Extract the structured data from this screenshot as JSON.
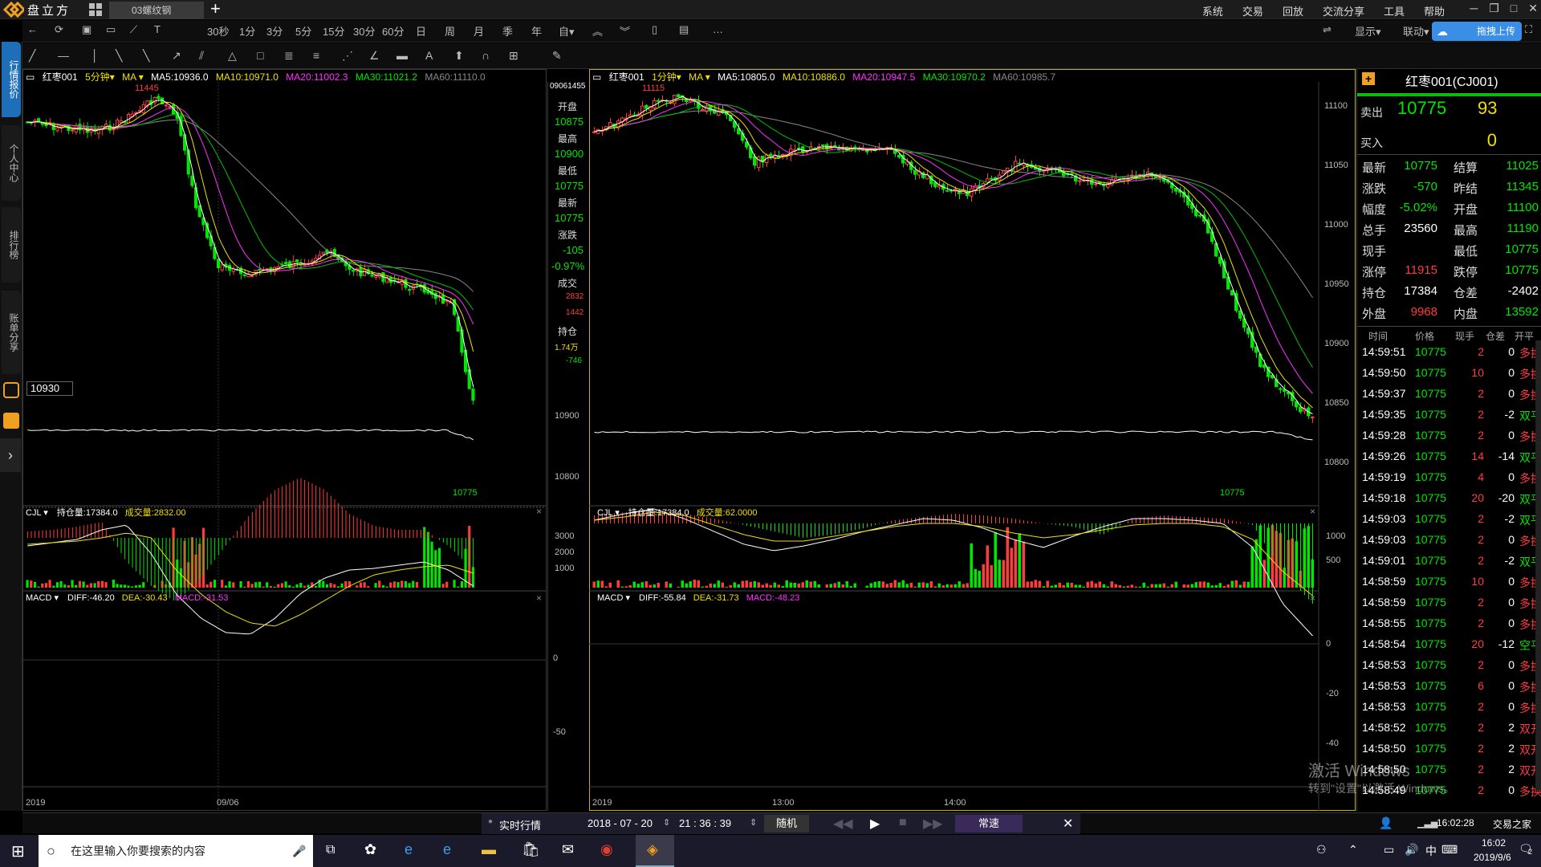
{
  "app": {
    "logo_text": "盘立方",
    "tab_title": "03螺纹钢",
    "menu": [
      "系统",
      "交易",
      "回放",
      "交流分享",
      "工具",
      "帮助"
    ],
    "upload_label": "拖拽上传"
  },
  "toolbar": {
    "periods": [
      "30秒",
      "1分",
      "3分",
      "5分",
      "15分",
      "30分",
      "60分",
      "日",
      "周",
      "月",
      "季",
      "年",
      "自▾"
    ],
    "right_items": [
      "显示▾",
      "联动▾"
    ]
  },
  "sidetabs": [
    "行情报价",
    "个人中心",
    "排行榜",
    "账单分享"
  ],
  "left_chart": {
    "header": {
      "symbol": "红枣001",
      "period": "5分钟▾",
      "ind": "MA ▾",
      "ma5": "MA5:10936.0",
      "ma10": "MA10:10971.0",
      "ma20": "MA20:11002.3",
      "ma30": "MA30:11021.2",
      "ma60": "MA60:11110.0"
    },
    "high_label": "11445",
    "low_label": "10775",
    "crosshair_price": "10930",
    "y_labels": [
      "10900",
      "10800"
    ],
    "info_panel": {
      "time": "09061455",
      "open_l": "开盘",
      "open_v": "10875",
      "high_l": "最高",
      "high_v": "10900",
      "low_l": "最低",
      "low_v": "10775",
      "last_l": "最新",
      "last_v": "10775",
      "chg_l": "涨跌",
      "chg_v": "-105",
      "pct_v": "-0.97%",
      "vol_l": "成交",
      "vol_v1": "2832",
      "vol_v2": "1442",
      "oi_l": "持仓",
      "oi_v1": "1.74万",
      "oi_v2": "-746"
    },
    "vol_header": {
      "name": "CJL ▾",
      "oi": "持仓量:17384.0",
      "vol": "成交量:2832.00"
    },
    "vol_y": [
      "3000",
      "2000",
      "1000"
    ],
    "macd_header": {
      "name": "MACD ▾",
      "diff": "DIFF:-46.20",
      "dea": "DEA:-30.43",
      "macd": "MACD:-31.53"
    },
    "macd_y": [
      "0",
      "-50"
    ],
    "x_labels": [
      "2019",
      "09/06"
    ]
  },
  "mid_chart": {
    "header": {
      "symbol": "红枣001",
      "period": "1分钟▾",
      "ind": "MA ▾",
      "ma5": "MA5:10805.0",
      "ma10": "MA10:10886.0",
      "ma20": "MA20:10947.5",
      "ma30": "MA30:10970.2",
      "ma60": "MA60:10985.7"
    },
    "high_label": "11115",
    "low_label": "10775",
    "y_labels": [
      "11100",
      "11050",
      "11000",
      "10950",
      "10900",
      "10850",
      "10800"
    ],
    "vol_header": {
      "name": "CJL ▾",
      "oi": "持仓量:17384.0",
      "vol": "成交量:62.0000"
    },
    "vol_y": [
      "1000",
      "500"
    ],
    "macd_header": {
      "name": "MACD ▾",
      "diff": "DIFF:-55.84",
      "dea": "DEA:-31.73",
      "macd": "MACD:-48.23"
    },
    "macd_y": [
      "0",
      "-20",
      "-40"
    ],
    "x_labels": [
      "2019",
      "13:00",
      "14:00"
    ]
  },
  "quote": {
    "title": "红枣001(CJ001)",
    "sell_l": "卖出",
    "sell_p": "10775",
    "sell_q": "93",
    "buy_l": "买入",
    "buy_q": "0",
    "rows": [
      {
        "l1": "最新",
        "v1": "10775",
        "c1": "green",
        "l2": "结算",
        "v2": "11025",
        "c2": "green"
      },
      {
        "l1": "涨跌",
        "v1": "-570",
        "c1": "green",
        "l2": "昨结",
        "v2": "11345",
        "c2": "green"
      },
      {
        "l1": "幅度",
        "v1": "-5.02%",
        "c1": "green",
        "l2": "开盘",
        "v2": "11100",
        "c2": "green"
      },
      {
        "l1": "总手",
        "v1": "23560",
        "c1": "white",
        "l2": "最高",
        "v2": "11190",
        "c2": "green"
      },
      {
        "l1": "现手",
        "v1": "",
        "c1": "white",
        "l2": "最低",
        "v2": "10775",
        "c2": "green"
      },
      {
        "l1": "涨停",
        "v1": "11915",
        "c1": "red",
        "l2": "跌停",
        "v2": "10775",
        "c2": "green"
      },
      {
        "l1": "持仓",
        "v1": "17384",
        "c1": "white",
        "l2": "仓差",
        "v2": "-2402",
        "c2": "white"
      },
      {
        "l1": "外盘",
        "v1": "9968",
        "c1": "red",
        "l2": "内盘",
        "v2": "13592",
        "c2": "green"
      }
    ],
    "tick_headers": [
      "时间",
      "价格",
      "现手",
      "仓差",
      "开平"
    ],
    "ticks": [
      {
        "t": "14:59:51",
        "p": "10775",
        "q": "2",
        "oi": "0",
        "f": "多换"
      },
      {
        "t": "14:59:50",
        "p": "10775",
        "q": "10",
        "oi": "0",
        "f": "多换"
      },
      {
        "t": "14:59:37",
        "p": "10775",
        "q": "2",
        "oi": "0",
        "f": "多换"
      },
      {
        "t": "14:59:35",
        "p": "10775",
        "q": "2",
        "oi": "-2",
        "f": "双平"
      },
      {
        "t": "14:59:28",
        "p": "10775",
        "q": "2",
        "oi": "0",
        "f": "多换"
      },
      {
        "t": "14:59:26",
        "p": "10775",
        "q": "14",
        "oi": "-14",
        "f": "双平"
      },
      {
        "t": "14:59:19",
        "p": "10775",
        "q": "4",
        "oi": "0",
        "f": "多换"
      },
      {
        "t": "14:59:18",
        "p": "10775",
        "q": "20",
        "oi": "-20",
        "f": "双平"
      },
      {
        "t": "14:59:03",
        "p": "10775",
        "q": "2",
        "oi": "-2",
        "f": "双平"
      },
      {
        "t": "14:59:03",
        "p": "10775",
        "q": "2",
        "oi": "0",
        "f": "多换"
      },
      {
        "t": "14:59:01",
        "p": "10775",
        "q": "2",
        "oi": "-2",
        "f": "双平"
      },
      {
        "t": "14:58:59",
        "p": "10775",
        "q": "10",
        "oi": "0",
        "f": "多换"
      },
      {
        "t": "14:58:59",
        "p": "10775",
        "q": "2",
        "oi": "0",
        "f": "多换"
      },
      {
        "t": "14:58:55",
        "p": "10775",
        "q": "2",
        "oi": "0",
        "f": "多换"
      },
      {
        "t": "14:58:54",
        "p": "10775",
        "q": "20",
        "oi": "-12",
        "f": "空平"
      },
      {
        "t": "14:58:53",
        "p": "10775",
        "q": "2",
        "oi": "0",
        "f": "多换"
      },
      {
        "t": "14:58:53",
        "p": "10775",
        "q": "6",
        "oi": "0",
        "f": "多换"
      },
      {
        "t": "14:58:53",
        "p": "10775",
        "q": "2",
        "oi": "0",
        "f": "多换"
      },
      {
        "t": "14:58:52",
        "p": "10775",
        "q": "2",
        "oi": "2",
        "f": "双开"
      },
      {
        "t": "14:58:50",
        "p": "10775",
        "q": "2",
        "oi": "2",
        "f": "双开"
      },
      {
        "t": "14:58:50",
        "p": "10775",
        "q": "2",
        "oi": "2",
        "f": "双开"
      },
      {
        "t": "14:58:49",
        "p": "10775",
        "q": "2",
        "oi": "0",
        "f": "多换"
      }
    ],
    "status_time": "16:02:28",
    "status_house": "交易之家"
  },
  "playbar": {
    "mode": "实时行情",
    "date": "2018 - 07 - 20",
    "time": "21 : 36 : 39",
    "random": "随机",
    "speed": "常速"
  },
  "watermark": {
    "line1": "激活 Windows",
    "line2": "转到\"设置\"以激活 Windows。"
  },
  "taskbar": {
    "search_placeholder": "在这里输入你要搜索的内容",
    "ime": "中",
    "time": "16:02",
    "date": "2019/9/6",
    "notif": "2"
  }
}
